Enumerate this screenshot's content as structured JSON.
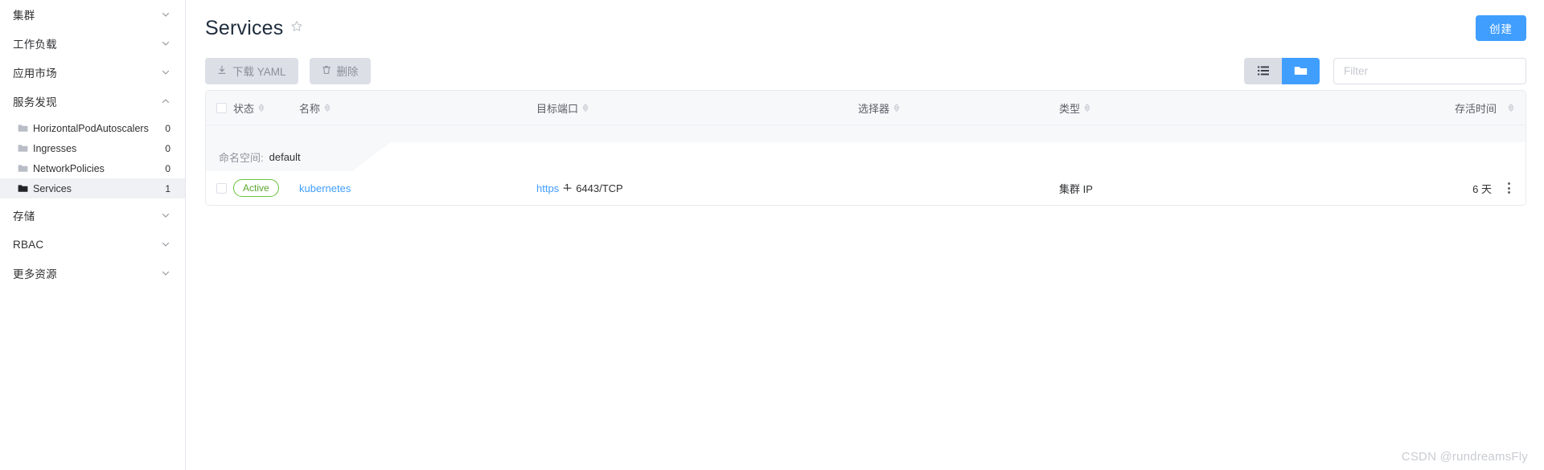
{
  "sidebar": {
    "groups": [
      {
        "label": "集群",
        "expanded": false,
        "icon": "chevron-down-icon"
      },
      {
        "label": "工作负载",
        "expanded": false,
        "icon": "chevron-down-icon"
      },
      {
        "label": "应用市场",
        "expanded": false,
        "icon": "chevron-down-icon"
      },
      {
        "label": "服务发现",
        "expanded": true,
        "icon": "chevron-up-icon"
      },
      {
        "label": "存储",
        "expanded": false,
        "icon": "chevron-down-icon"
      },
      {
        "label": "RBAC",
        "expanded": false,
        "icon": "chevron-down-icon"
      },
      {
        "label": "更多资源",
        "expanded": false,
        "icon": "chevron-down-icon"
      }
    ],
    "sub_items": [
      {
        "label": "HorizontalPodAutoscalers",
        "count": "0",
        "active": false,
        "icon": "folder-icon"
      },
      {
        "label": "Ingresses",
        "count": "0",
        "active": false,
        "icon": "folder-icon"
      },
      {
        "label": "NetworkPolicies",
        "count": "0",
        "active": false,
        "icon": "folder-icon"
      },
      {
        "label": "Services",
        "count": "1",
        "active": true,
        "icon": "folder-icon"
      }
    ]
  },
  "header": {
    "title": "Services",
    "favorite_icon": "star-outline-icon",
    "create_label": "创建"
  },
  "toolbar": {
    "download_yaml_label": "下载 YAML",
    "download_icon": "download-icon",
    "delete_label": "删除",
    "delete_icon": "trash-icon",
    "view_list_icon": "list-view-icon",
    "view_group_icon": "folder-view-icon",
    "active_view": "folder-view-icon",
    "filter_placeholder": "Filter",
    "filter_value": ""
  },
  "table": {
    "columns": [
      {
        "label": "状态",
        "sortable": true
      },
      {
        "label": "名称",
        "sortable": true
      },
      {
        "label": "目标端口",
        "sortable": true
      },
      {
        "label": "选择器",
        "sortable": true
      },
      {
        "label": "类型",
        "sortable": true
      },
      {
        "label": "存活时间",
        "sortable": true
      }
    ],
    "group": {
      "key_label": "命名空间:",
      "value": "default"
    },
    "rows": [
      {
        "status": "Active",
        "name": "kubernetes",
        "port_protocol": "https",
        "port_separator_icon": "port-arrow-icon",
        "port_value": "6443/TCP",
        "selector": "",
        "type": "集群 IP",
        "age": "6 天",
        "menu_icon": "more-vertical-icon"
      }
    ]
  },
  "watermark": "CSDN @rundreamsFly",
  "colors": {
    "accent": "#409eff",
    "status_green": "#67c23a",
    "header_bg": "#f7f8fa",
    "disabled_btn": "#dcdfe6"
  }
}
